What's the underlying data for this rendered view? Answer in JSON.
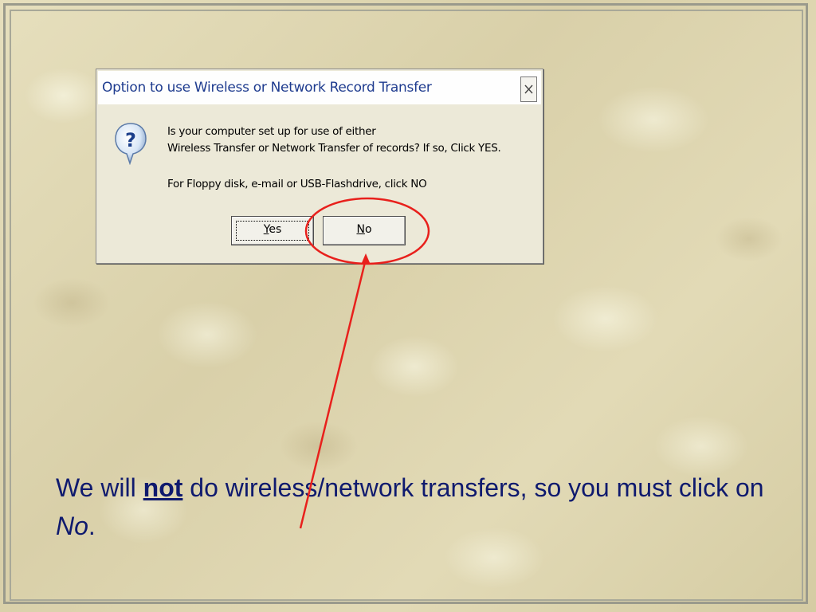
{
  "dialog": {
    "title": "Option to use Wireless or Network Record Transfer",
    "icon": "question-icon",
    "message_line1": "Is your computer set up for use of either",
    "message_line2": "Wireless Transfer or Network Transfer of records?  If so, Click YES.",
    "message_line3": "For Floppy disk, e-mail or USB-Flashdrive, click NO",
    "close_label": "×",
    "yes_mnemonic": "Y",
    "yes_rest": "es",
    "no_mnemonic": "N",
    "no_rest": "o"
  },
  "caption": {
    "part1": "We will ",
    "emphasis": "not",
    "part2": " do wireless/network transfers, so you must click on ",
    "italic": "No",
    "part3": "."
  },
  "colors": {
    "title_text": "#1f3c8f",
    "caption_text": "#0f1a6e",
    "annotation_red": "#e8201c",
    "dialog_bg": "#ece9d8"
  }
}
